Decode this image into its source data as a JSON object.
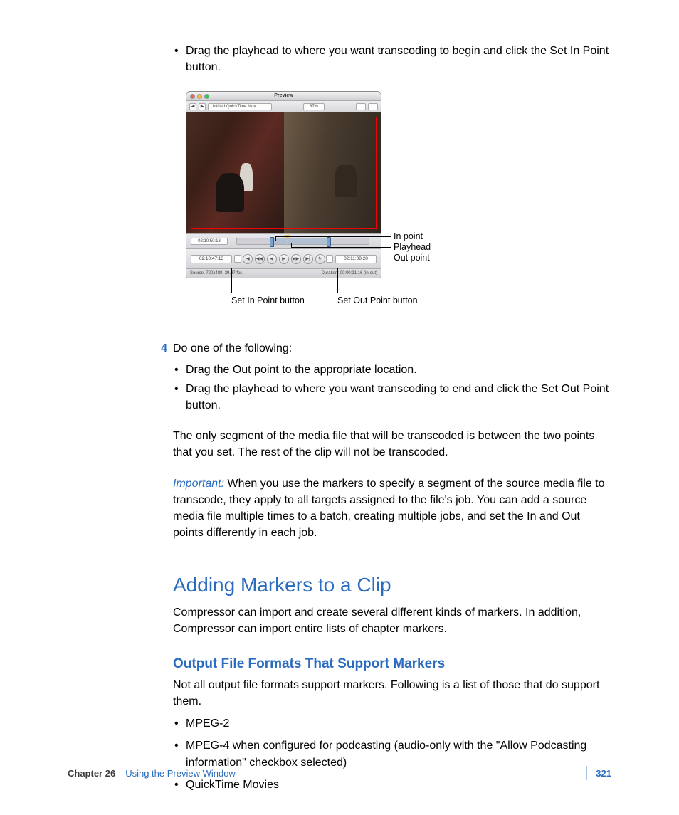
{
  "bullets_top": [
    "Drag the playhead to where you want transcoding to begin and click the Set In Point button."
  ],
  "figure": {
    "window_title": "Preview",
    "source_menu": "Untitled QuickTime Mov",
    "scale": "87%",
    "tc_left": "02:10:47:13",
    "tc_right": "02:11:08:20",
    "tc_track_left": "02:10:50:18",
    "status_left": "Source: 720x480, 29.97 fps",
    "status_right": "Duration: 00:00:21:16 (in-out)",
    "callouts": {
      "in_point": "In point",
      "playhead": "Playhead",
      "out_point": "Out point",
      "set_in": "Set In Point button",
      "set_out": "Set Out Point button"
    }
  },
  "step4": {
    "num": "4",
    "lead": "Do one of the following:",
    "bullets": [
      "Drag the Out point to the appropriate location.",
      "Drag the playhead to where you want transcoding to end and click the Set Out Point button."
    ]
  },
  "para_transcode": "The only segment of the media file that will be transcoded is between the two points that you set. The rest of the clip will not be transcoded.",
  "important_label": "Important:",
  "important_text": "When you use the markers to specify a segment of the source media file to transcode, they apply to all targets assigned to the file's job. You can add a source media file multiple times to a batch, creating multiple jobs, and set the In and Out points differently in each job.",
  "h1": "Adding Markers to a Clip",
  "h1_body": "Compressor can import and create several different kinds of markers. In addition, Compressor can import entire lists of chapter markers.",
  "h2": "Output File Formats That Support Markers",
  "h2_body": "Not all output file formats support markers. Following is a list of those that do support them.",
  "formats": [
    "MPEG-2",
    "MPEG-4 when configured for podcasting (audio-only with the \"Allow Podcasting information\" checkbox selected)",
    "QuickTime Movies"
  ],
  "footer": {
    "chapter": "Chapter 26",
    "title": "Using the Preview Window",
    "page": "321"
  }
}
